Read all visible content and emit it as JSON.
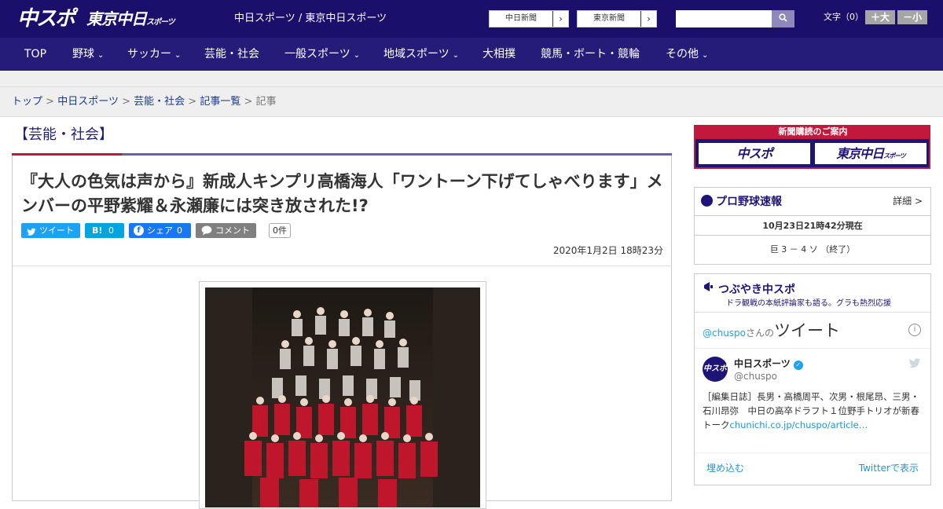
{
  "header": {
    "logo_chuspo": "中スポ",
    "logo_tokyo": "東京中日",
    "logo_tokyo_small": "スポーツ",
    "site_names": "中日スポーツ / 東京中日スポーツ",
    "paper_links": [
      {
        "label": "中日新聞",
        "arrow": "›"
      },
      {
        "label": "東京新聞",
        "arrow": "›"
      }
    ],
    "search": {
      "placeholder": "",
      "icon": "search-icon",
      "glyph": "🔍"
    },
    "font_size": {
      "label": "文字（0）",
      "increase": "＋大",
      "decrease": "－小"
    }
  },
  "nav": {
    "items": [
      {
        "label": "TOP",
        "dropdown": false
      },
      {
        "label": "野球",
        "dropdown": true
      },
      {
        "label": "サッカー",
        "dropdown": true
      },
      {
        "label": "芸能・社会",
        "dropdown": false
      },
      {
        "label": "一般スポーツ",
        "dropdown": true
      },
      {
        "label": "地域スポーツ",
        "dropdown": true
      },
      {
        "label": "大相撲",
        "dropdown": false
      },
      {
        "label": "競馬・ボート・競輪",
        "dropdown": false
      },
      {
        "label": "その他",
        "dropdown": true
      }
    ],
    "chevron": "⌄"
  },
  "breadcrumb": {
    "items": [
      "トップ",
      "中日スポーツ",
      "芸能・社会",
      "記事一覧"
    ],
    "separator": ">",
    "current": "記事"
  },
  "article": {
    "category": "【芸能・社会】",
    "title": "『大人の色気は声から』新成人キンプリ高橋海人「ワントーン下げてしゃべります」メンバーの平野紫耀＆永瀬廉には突き放された!?",
    "share": {
      "tweet": "ツイート",
      "hatena": "B!",
      "hatena_count": "0",
      "facebook": "シェア",
      "facebook_count": "0",
      "comment": "コメント",
      "comment_count": "0件"
    },
    "date": "2020年1月2日 18時23分"
  },
  "sidebar": {
    "subscription": {
      "heading": "新聞購読のご案内",
      "chuspo": "中スポ",
      "tokyo": "東京中日",
      "tokyo_small": "スポーツ"
    },
    "baseball": {
      "title": "プロ野球速報",
      "detail": "詳細 >",
      "timestamp": "10月23日21時42分現在",
      "score": "巨 3 － 4 ソ （終了）"
    },
    "tsubuyaki": {
      "title": "つぶやき中スポ",
      "subtitle": "ドラ観戦の本紙評論家も語る。グラも熱烈応援",
      "tweets_by": "@chuspo",
      "tweets_suffix": "さんの",
      "tweets_label": "ツイート",
      "info": "i",
      "account_name": "中日スポーツ",
      "account_handle": "@chuspo",
      "avatar_text": "中スポ",
      "verified_glyph": "✓",
      "tweet_text": "［編集日誌］長男・高橋周平、次男・根尾昂、三男・石川昂弥　中日の高卒ドラフト１位野手トリオが新春トーク",
      "tweet_link": "chunichi.co.jp/chuspo/article…",
      "embed": "埋め込む",
      "view_on": "Twitterで表示"
    }
  },
  "colors": {
    "header_bg": "#1a0f6b",
    "nav_bg": "#251c7a",
    "accent_red": "#c2183b",
    "accent_purple": "#6b5fa5",
    "twitter_blue": "#1da1f2",
    "facebook_blue": "#1877f2",
    "hatena_blue": "#00a4de",
    "comment_gray": "#808080"
  }
}
